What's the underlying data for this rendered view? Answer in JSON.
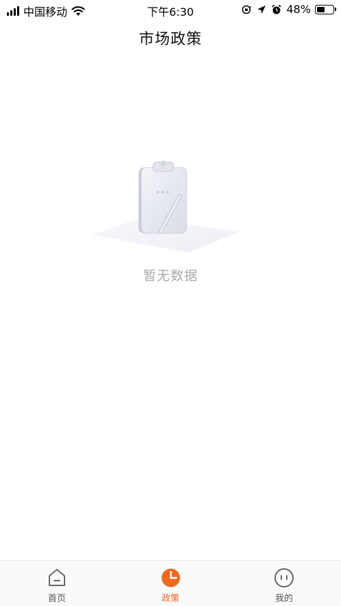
{
  "status_bar": {
    "carrier": "中国移动",
    "time": "下午6:30",
    "battery_percent": "48%",
    "battery_level": 0.48,
    "icons": [
      "signal-icon",
      "wifi-icon",
      "orientation-lock-icon",
      "location-arrow-icon",
      "alarm-icon",
      "battery-icon"
    ]
  },
  "header": {
    "title": "市场政策"
  },
  "empty_state": {
    "message": "暂无数据",
    "illustration": "clipboard-pen-icon"
  },
  "tab_bar": {
    "accent_color": "#ee6a23",
    "inactive_color": "#555555",
    "tabs": [
      {
        "label": "首页",
        "icon": "home-icon",
        "active": false
      },
      {
        "label": "政策",
        "icon": "pie-chart-icon",
        "active": true
      },
      {
        "label": "我的",
        "icon": "face-icon",
        "active": false
      }
    ]
  }
}
